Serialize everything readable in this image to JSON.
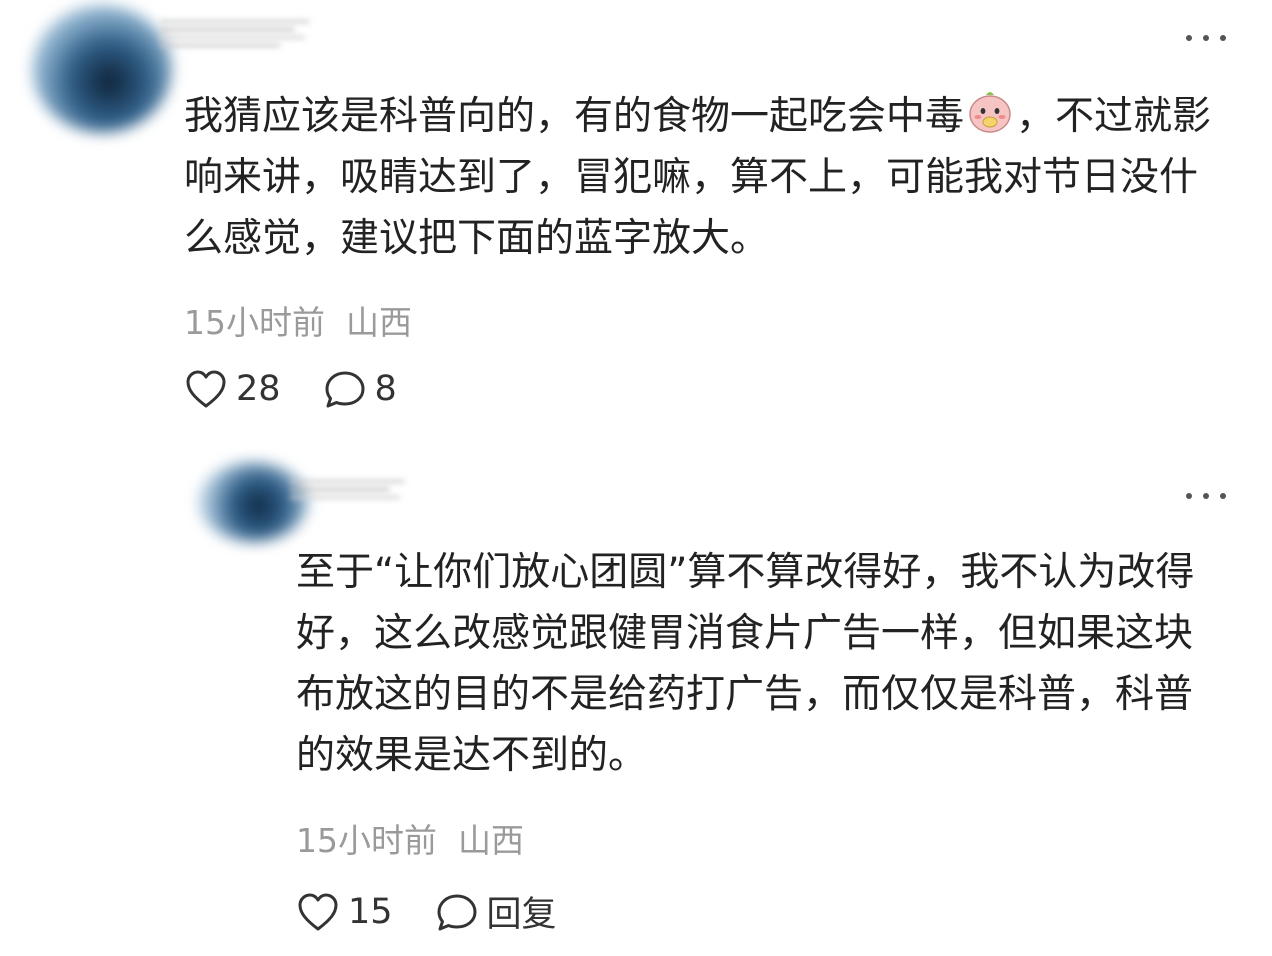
{
  "comments": [
    {
      "text_before_emoji": "我猜应该是科普向的，有的食物一起吃会中毒",
      "emoji_icon": "cute-pink-character-emoji",
      "text_after_emoji": "，不过就影响来讲，吸睛达到了，冒犯嘛，算不上，可能我对节日没什么感觉，建议把下面的蓝字放大。",
      "meta": "15小时前  山西",
      "likes": "28",
      "replies": "8",
      "more_icon": "more-dots-icon"
    },
    {
      "text": "至于“让你们放心团圆”算不算改得好，我不认为改得好，这么改感觉跟健胃消食片广告一样，但如果这块布放这的目的不是给药打广告，而仅仅是科普，科普的效果是达不到的。",
      "meta": "15小时前  山西",
      "likes": "15",
      "reply_label": "回复",
      "more_icon": "more-dots-icon"
    }
  ],
  "colors": {
    "text": "#222222",
    "meta": "#9a9a9a",
    "icon": "#333333",
    "avatar_blue": "#2f5d86"
  }
}
